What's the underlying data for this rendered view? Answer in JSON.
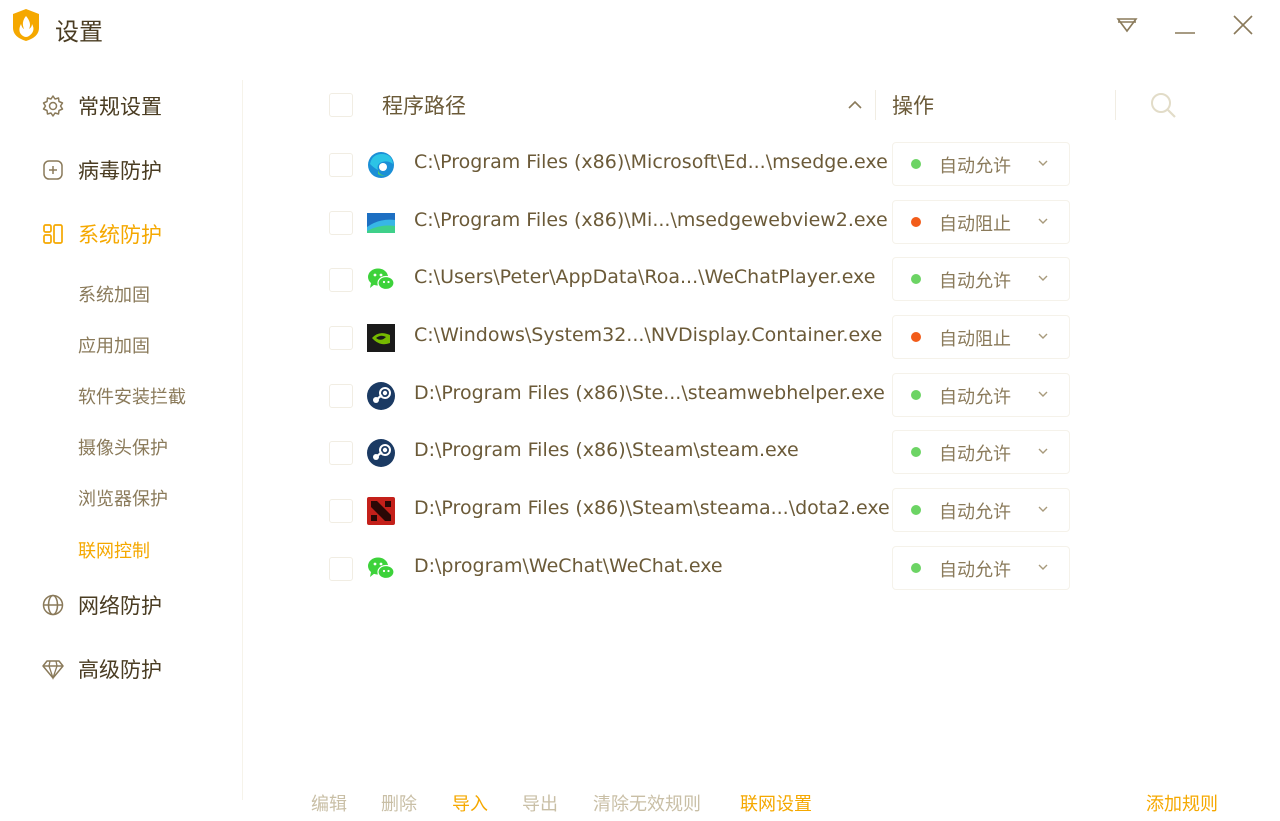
{
  "window": {
    "title": "设置"
  },
  "sidebar": {
    "main": [
      {
        "label": "常规设置",
        "icon": "gear-icon"
      },
      {
        "label": "病毒防护",
        "icon": "plus-square-icon"
      },
      {
        "label": "系统防护",
        "icon": "grid-icon",
        "active": true
      },
      {
        "label": "网络防护",
        "icon": "globe-icon"
      },
      {
        "label": "高级防护",
        "icon": "diamond-icon"
      }
    ],
    "sub": [
      {
        "label": "系统加固"
      },
      {
        "label": "应用加固"
      },
      {
        "label": "软件安装拦截"
      },
      {
        "label": "摄像头保护"
      },
      {
        "label": "浏览器保护"
      },
      {
        "label": "联网控制",
        "active": true
      }
    ]
  },
  "table": {
    "col_path": "程序路径",
    "col_action": "操作",
    "rows": [
      {
        "icon": "edge-icon",
        "path": "C:\\Program Files (x86)\\Microsoft\\Ed...\\msedge.exe",
        "action": "自动允许",
        "status": "allow"
      },
      {
        "icon": "webview-icon",
        "path": "C:\\Program Files (x86)\\Mi...\\msedgewebview2.exe",
        "action": "自动阻止",
        "status": "block"
      },
      {
        "icon": "wechat-icon",
        "path": "C:\\Users\\Peter\\AppData\\Roa...\\WeChatPlayer.exe",
        "action": "自动允许",
        "status": "allow"
      },
      {
        "icon": "nvidia-icon",
        "path": "C:\\Windows\\System32...\\NVDisplay.Container.exe",
        "action": "自动阻止",
        "status": "block"
      },
      {
        "icon": "steam-icon",
        "path": "D:\\Program Files (x86)\\Ste...\\steamwebhelper.exe",
        "action": "自动允许",
        "status": "allow"
      },
      {
        "icon": "steam-icon",
        "path": "D:\\Program Files (x86)\\Steam\\steam.exe",
        "action": "自动允许",
        "status": "allow"
      },
      {
        "icon": "dota2-icon",
        "path": "D:\\Program Files (x86)\\Steam\\steama...\\dota2.exe",
        "action": "自动允许",
        "status": "allow"
      },
      {
        "icon": "wechat-icon",
        "path": "D:\\program\\WeChat\\WeChat.exe",
        "action": "自动允许",
        "status": "allow"
      }
    ]
  },
  "footer": {
    "edit": "编辑",
    "delete": "删除",
    "import": "导入",
    "export": "导出",
    "clear_invalid": "清除无效规则",
    "network_settings": "联网设置",
    "add_rule": "添加规则"
  },
  "colors": {
    "accent": "#f5a800",
    "allow": "#6cd464",
    "block": "#f25c1a",
    "text": "#6b5a38",
    "muted": "#b8ab8c"
  }
}
